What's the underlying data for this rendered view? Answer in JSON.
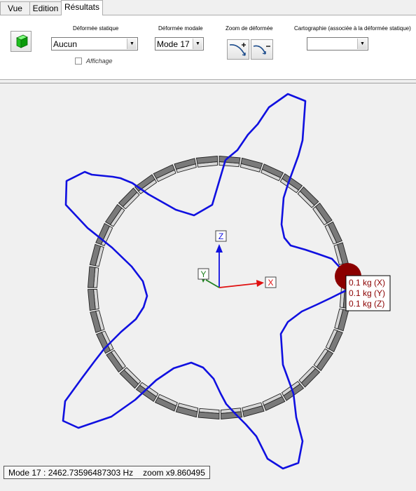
{
  "tabs": [
    {
      "label": "Vue",
      "active": false
    },
    {
      "label": "Edition",
      "active": false
    },
    {
      "label": "Résultats",
      "active": true
    }
  ],
  "ribbon": {
    "static_deformation": {
      "title": "Déformée statique",
      "value": "Aucun",
      "display_checkbox_label": "Affichage",
      "display_checked": false
    },
    "modal_deformation": {
      "title": "Déformée modale",
      "value": "Mode 17"
    },
    "zoom": {
      "title": "Zoom de déformée",
      "zoom_in_icon": "zoom-in-curve-icon",
      "zoom_out_icon": "zoom-out-curve-icon"
    },
    "mapping": {
      "title": "Cartographie (associée à la déformée statique)",
      "value": ""
    },
    "cube_icon": "green-cube-icon"
  },
  "viewport": {
    "axes": {
      "z": "Z",
      "y": "Y",
      "x": "X"
    },
    "mass_labels": [
      "0.1 kg (X)",
      "0.1 kg (Y)",
      "0.1 kg (Z)"
    ],
    "colors": {
      "mode_shape": "#1010e0",
      "axis_z": "#1010e0",
      "axis_x": "#e01010",
      "axis_y": "#208020",
      "mass": "#8b0000",
      "ring": "#7a7a7a"
    }
  },
  "status": {
    "mode_text": "Mode 17 : 2462.73596487303 Hz",
    "zoom_text": "zoom x9.860495"
  }
}
